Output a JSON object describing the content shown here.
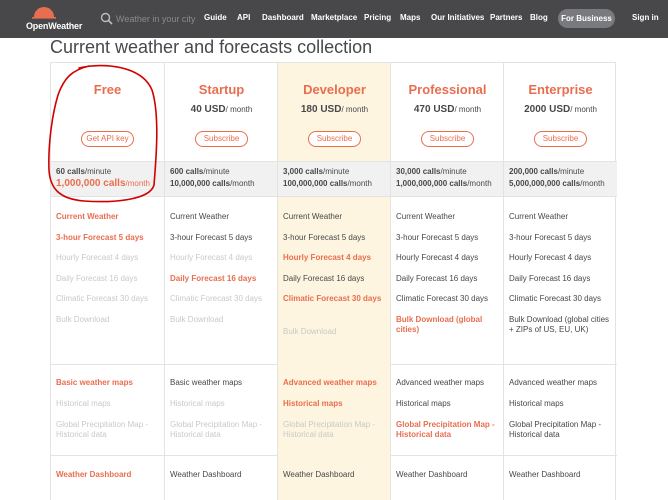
{
  "nav": {
    "logo_text": "OpenWeather",
    "search_placeholder": "Weather in your city",
    "links": [
      "Guide",
      "API",
      "Dashboard",
      "Marketplace",
      "Pricing",
      "Maps",
      "Our Initiatives",
      "Partners",
      "Blog"
    ],
    "business_button": "For Business",
    "sign_in": "Sign in"
  },
  "page_title": "Current weather and forecasts collection",
  "colors": {
    "accent": "#e96e50",
    "nav_bg": "#48484a",
    "highlight_col": "#fdf5df",
    "annotation": "#d10000"
  },
  "plans": [
    {
      "name": "Free",
      "price": "",
      "price_unit": "",
      "button": "Get API key",
      "calls_minute": "60 calls",
      "calls_minute_unit": "/minute",
      "calls_month": "1,000,000 calls",
      "calls_month_unit": "/month",
      "weather": [
        {
          "text": "Current Weather",
          "state": "on"
        },
        {
          "text": "3-hour Forecast 5 days",
          "state": "on"
        },
        {
          "text": "Hourly Forecast 4 days",
          "state": "off"
        },
        {
          "text": "Daily Forecast 16 days",
          "state": "off"
        },
        {
          "text": "Climatic Forecast 30 days",
          "state": "off"
        },
        {
          "text": "Bulk Download",
          "state": "off"
        }
      ],
      "maps": [
        {
          "text": "Basic weather maps",
          "state": "on"
        },
        {
          "text": "Historical maps",
          "state": "off"
        },
        {
          "text": "Global Precipitation Map - Historical data",
          "state": "off"
        }
      ],
      "dashboard": {
        "text": "Weather Dashboard",
        "state": "on"
      }
    },
    {
      "name": "Startup",
      "price": "40 USD",
      "price_unit": "/ month",
      "button": "Subscribe",
      "calls_minute": "600 calls",
      "calls_minute_unit": "/minute",
      "calls_month": "10,000,000 calls",
      "calls_month_unit": "/month",
      "weather": [
        {
          "text": "Current Weather",
          "state": "normal"
        },
        {
          "text": "3-hour Forecast 5 days",
          "state": "normal"
        },
        {
          "text": "Hourly Forecast 4 days",
          "state": "off"
        },
        {
          "text": "Daily Forecast 16 days",
          "state": "on"
        },
        {
          "text": "Climatic Forecast 30 days",
          "state": "off"
        },
        {
          "text": "Bulk Download",
          "state": "off"
        }
      ],
      "maps": [
        {
          "text": "Basic weather maps",
          "state": "normal"
        },
        {
          "text": "Historical maps",
          "state": "off"
        },
        {
          "text": "Global Precipitation Map - Historical data",
          "state": "off"
        }
      ],
      "dashboard": {
        "text": "Weather Dashboard",
        "state": "normal"
      }
    },
    {
      "name": "Developer",
      "price": "180 USD",
      "price_unit": "/ month",
      "button": "Subscribe",
      "calls_minute": "3,000 calls",
      "calls_minute_unit": "/minute",
      "calls_month": "100,000,000 calls",
      "calls_month_unit": "/month",
      "weather": [
        {
          "text": "Current Weather",
          "state": "normal"
        },
        {
          "text": "3-hour Forecast 5 days",
          "state": "normal"
        },
        {
          "text": "Hourly Forecast 4 days",
          "state": "on"
        },
        {
          "text": "Daily Forecast 16 days",
          "state": "normal"
        },
        {
          "text": "Climatic Forecast 30 days",
          "state": "on"
        },
        {
          "text": "Bulk Download",
          "state": "off"
        }
      ],
      "maps": [
        {
          "text": "Advanced weather maps",
          "state": "on"
        },
        {
          "text": "Historical maps",
          "state": "on"
        },
        {
          "text": "Global Precipitation Map - Historical data",
          "state": "off"
        }
      ],
      "dashboard": {
        "text": "Weather Dashboard",
        "state": "normal"
      }
    },
    {
      "name": "Professional",
      "price": "470 USD",
      "price_unit": "/ month",
      "button": "Subscribe",
      "calls_minute": "30,000 calls",
      "calls_minute_unit": "/minute",
      "calls_month": "1,000,000,000 calls",
      "calls_month_unit": "/month",
      "weather": [
        {
          "text": "Current Weather",
          "state": "normal"
        },
        {
          "text": "3-hour Forecast 5 days",
          "state": "normal"
        },
        {
          "text": "Hourly Forecast 4 days",
          "state": "normal"
        },
        {
          "text": "Daily Forecast 16 days",
          "state": "normal"
        },
        {
          "text": "Climatic Forecast 30 days",
          "state": "normal"
        },
        {
          "text": "Bulk Download (global cities)",
          "state": "on"
        }
      ],
      "maps": [
        {
          "text": "Advanced weather maps",
          "state": "normal"
        },
        {
          "text": "Historical maps",
          "state": "normal"
        },
        {
          "text": "Global Precipitation Map - Historical data",
          "state": "on"
        }
      ],
      "dashboard": {
        "text": "Weather Dashboard",
        "state": "normal"
      }
    },
    {
      "name": "Enterprise",
      "price": "2000 USD",
      "price_unit": "/ month",
      "button": "Subscribe",
      "calls_minute": "200,000 calls",
      "calls_minute_unit": "/minute",
      "calls_month": "5,000,000,000 calls",
      "calls_month_unit": "/month",
      "weather": [
        {
          "text": "Current Weather",
          "state": "normal"
        },
        {
          "text": "3-hour Forecast 5 days",
          "state": "normal"
        },
        {
          "text": "Hourly Forecast 4 days",
          "state": "normal"
        },
        {
          "text": "Daily Forecast 16 days",
          "state": "normal"
        },
        {
          "text": "Climatic Forecast 30 days",
          "state": "normal"
        },
        {
          "text": "Bulk Download (global cities + ZIPs of US, EU, UK)",
          "state": "normal"
        }
      ],
      "maps": [
        {
          "text": "Advanced weather maps",
          "state": "normal"
        },
        {
          "text": "Historical maps",
          "state": "normal"
        },
        {
          "text": "Global Precipitation Map - Historical data",
          "state": "normal"
        }
      ],
      "dashboard": {
        "text": "Weather Dashboard",
        "state": "normal"
      }
    }
  ]
}
